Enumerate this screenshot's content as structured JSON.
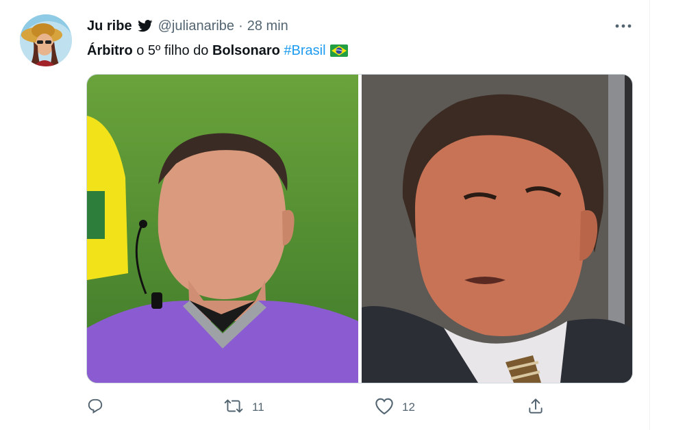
{
  "tweet": {
    "display_name": "Ju ribe",
    "handle": "@julianaribe",
    "separator": "·",
    "time": "28 min",
    "text": {
      "part1": "Árbitro",
      "part2": " o 5º filho do ",
      "part3": "Bolsonaro",
      "part4": " ",
      "hashtag": "#Brasil"
    },
    "media_count": 2,
    "actions": {
      "reply_count": "",
      "retweet_count": "11",
      "like_count": "12"
    }
  },
  "icons": {
    "verified_bird": "twitter-bird-icon",
    "flag": "brazil-flag-emoji",
    "more": "more-dots-icon",
    "reply": "reply-icon",
    "retweet": "retweet-icon",
    "like": "heart-icon",
    "share": "share-icon"
  },
  "colors": {
    "accent": "#1d9bf0",
    "text": "#0f1419",
    "secondary": "#536471",
    "border": "#cfd9de"
  }
}
